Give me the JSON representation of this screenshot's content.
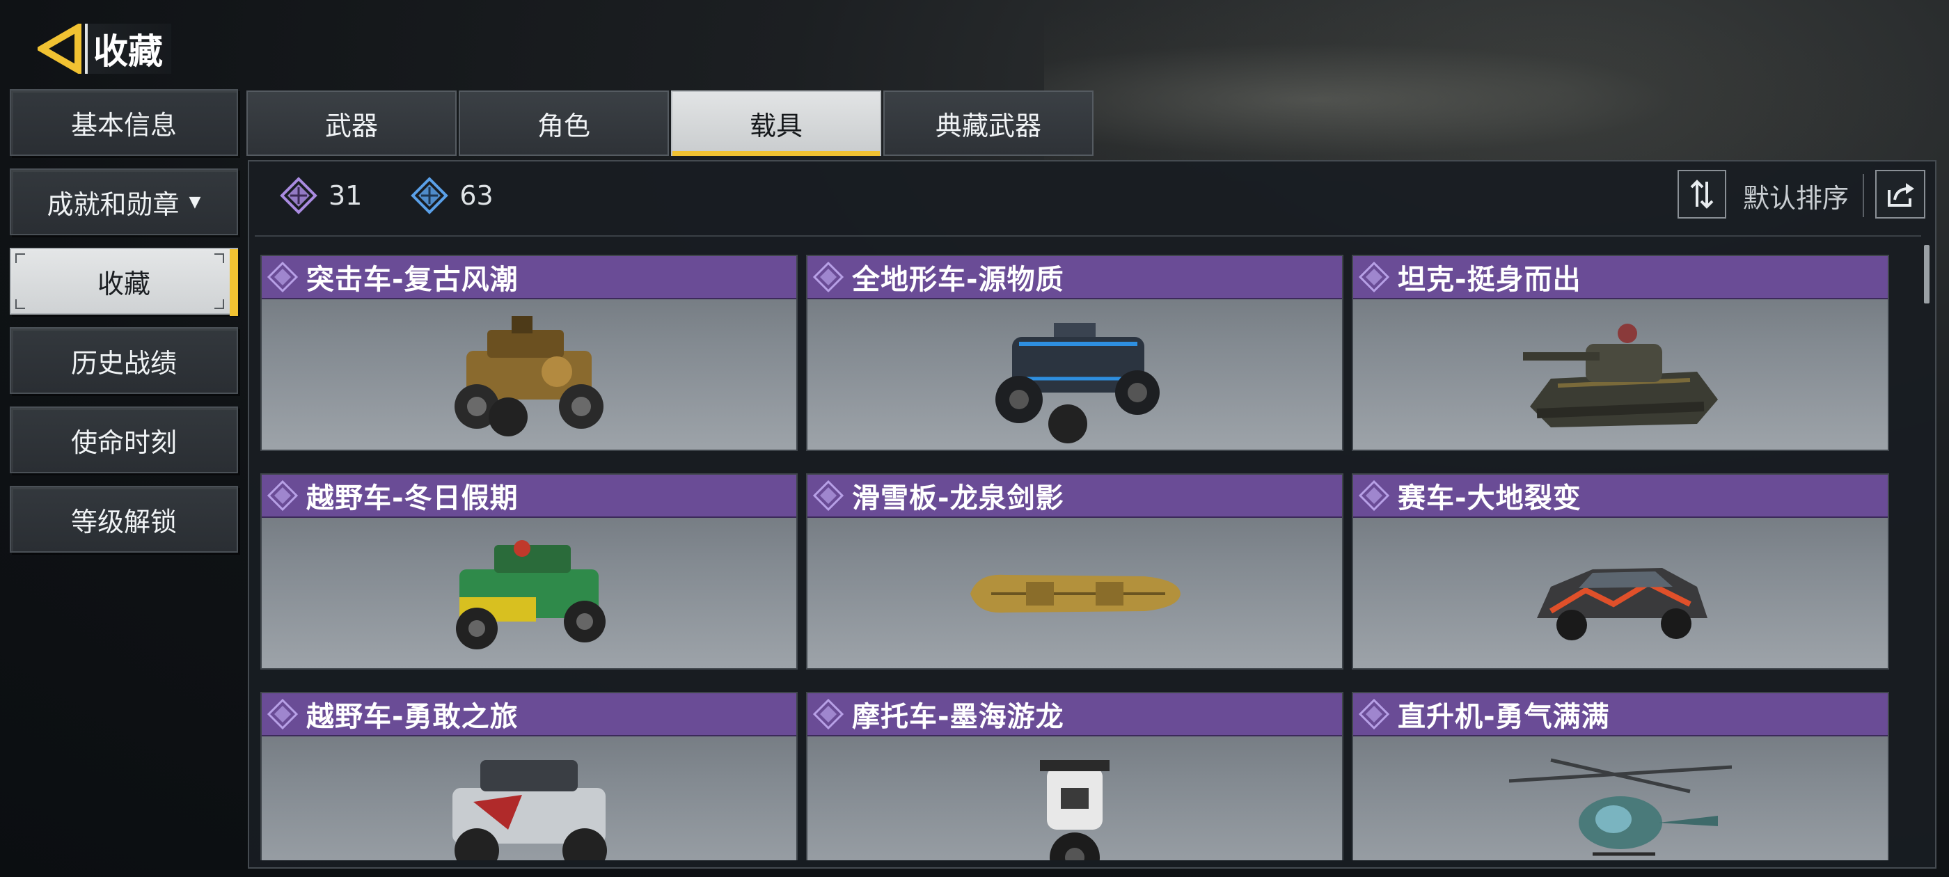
{
  "header": {
    "title": "收藏"
  },
  "sidebar": {
    "items": [
      {
        "label": "基本信息"
      },
      {
        "label": "成就和勋章",
        "caret": "▼"
      },
      {
        "label": "收藏"
      },
      {
        "label": "历史战绩"
      },
      {
        "label": "使命时刻"
      },
      {
        "label": "等级解锁"
      }
    ],
    "active_index": 2
  },
  "tabs": [
    {
      "label": "武器"
    },
    {
      "label": "角色"
    },
    {
      "label": "载具"
    },
    {
      "label": "典藏武器"
    }
  ],
  "active_tab_index": 2,
  "counts": {
    "purple_count": "31",
    "blue_count": "63"
  },
  "sort": {
    "label": "默认排序"
  },
  "cards": [
    {
      "name": "突击车-复古风潮",
      "vehicle_icon": "assault-buggy-icon"
    },
    {
      "name": "全地形车-源物质",
      "vehicle_icon": "atv-icon"
    },
    {
      "name": "坦克-挺身而出",
      "vehicle_icon": "tank-icon"
    },
    {
      "name": "越野车-冬日假期",
      "vehicle_icon": "offroad-jeep-icon"
    },
    {
      "name": "滑雪板-龙泉剑影",
      "vehicle_icon": "snowboard-icon"
    },
    {
      "name": "赛车-大地裂变",
      "vehicle_icon": "race-car-icon"
    },
    {
      "name": "越野车-勇敢之旅",
      "vehicle_icon": "offroad-truck-icon"
    },
    {
      "name": "摩托车-墨海游龙",
      "vehicle_icon": "motorcycle-icon"
    },
    {
      "name": "直升机-勇气满满",
      "vehicle_icon": "helicopter-icon"
    }
  ],
  "colors": {
    "accent_yellow": "#f1c232",
    "card_title_purple": "#6a4c96",
    "purple_tier": "#a98be0",
    "blue_tier": "#5aa0e8"
  }
}
